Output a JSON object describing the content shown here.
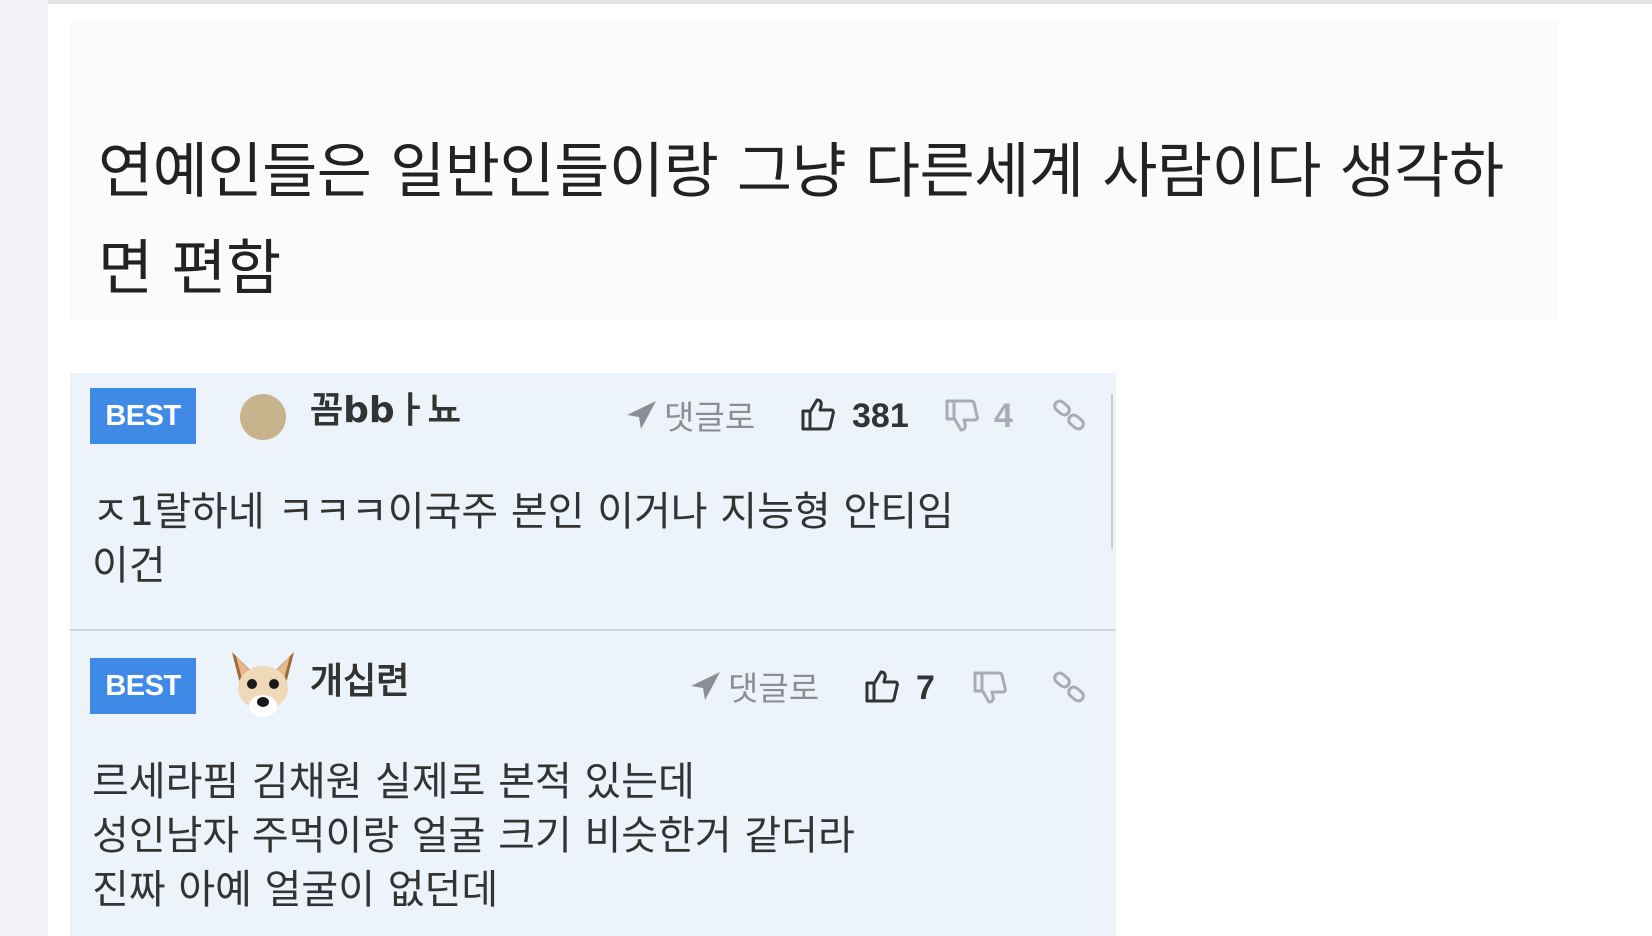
{
  "post": {
    "title": "연예인들은 일반인들이랑 그냥 다른세계 사람이다 생각하면 편함"
  },
  "comments": [
    {
      "badge": "BEST",
      "nickname": "꼼bbㅏ뇨",
      "reply_label": "댓글로",
      "likes": "381",
      "dislikes": "4",
      "body": "ㅈ1랄하네 ㅋㅋㅋ이국주 본인 이거나 지능형 안티임\n이건"
    },
    {
      "badge": "BEST",
      "nickname": "개십련",
      "reply_label": "댓글로",
      "likes": "7",
      "dislikes": "",
      "body": "르세라핌 김채원 실제로 본적 있는데\n성인남자 주먹이랑 얼굴 크기 비슷한거 같더라\n진짜 아예 얼굴이 없던데"
    }
  ],
  "colors": {
    "badge": "#3f8ae6",
    "comment_bg": "#edf3fb",
    "title_bg": "#fafbfc",
    "muted": "#8a8f96"
  },
  "icons": [
    "send-arrow-icon",
    "thumbs-up-icon",
    "thumbs-down-icon",
    "link-icon"
  ]
}
